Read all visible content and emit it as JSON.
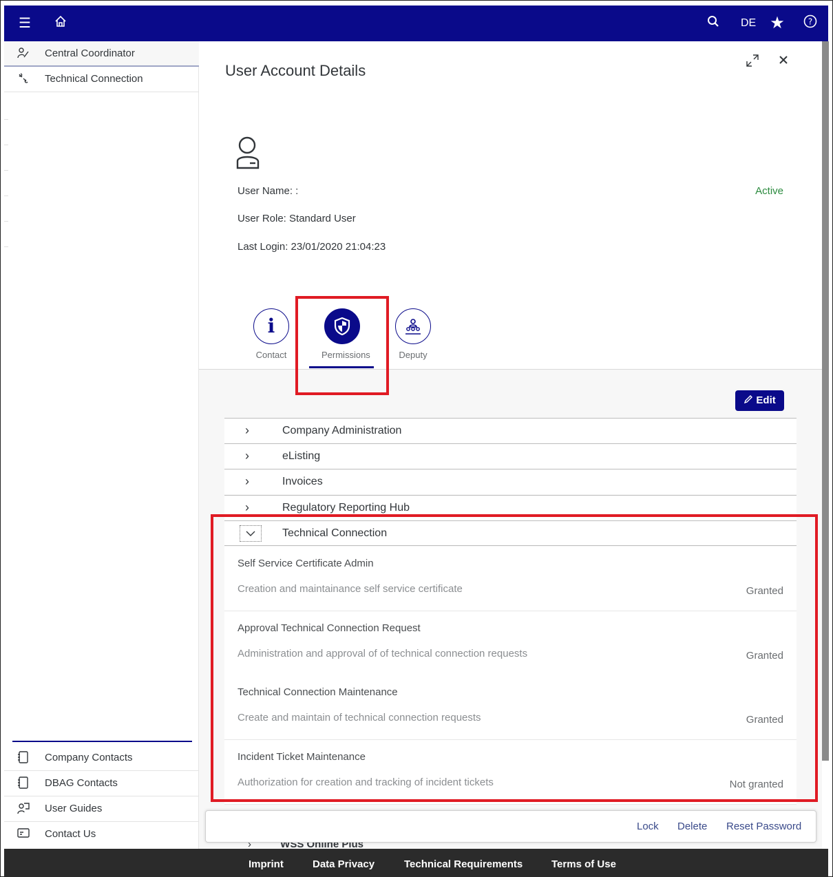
{
  "topbar": {
    "icons": [
      "menu-icon",
      "home-icon",
      "search-icon",
      "star-icon",
      "help-icon"
    ],
    "language": "DE"
  },
  "sidebar": {
    "items": [
      {
        "label": "Central Coordinator",
        "icon": "coordinator-icon"
      },
      {
        "label": "Technical Connection",
        "icon": "connection-icon"
      }
    ],
    "bottom_items": [
      {
        "label": "Company Contacts",
        "icon": "address-book-icon"
      },
      {
        "label": "DBAG Contacts",
        "icon": "address-book-icon"
      },
      {
        "label": "User Guides",
        "icon": "guide-icon"
      },
      {
        "label": "Contact Us",
        "icon": "contact-card-icon"
      }
    ]
  },
  "panel": {
    "title": "User Account Details",
    "user": {
      "name_label": "User Name: :",
      "role_label": "User Role: Standard User",
      "last_login_label": "Last Login: 23/01/2020 21:04:23",
      "status": "Active",
      "status_color": "#2b8a3e"
    },
    "tabs": [
      {
        "label": "Contact",
        "icon": "info-icon"
      },
      {
        "label": "Permissions",
        "icon": "shield-icon",
        "selected": true
      },
      {
        "label": "Deputy",
        "icon": "group-icon"
      }
    ],
    "edit_label": "Edit",
    "accordions": [
      {
        "label": "Company Administration",
        "expanded": false
      },
      {
        "label": "eListing",
        "expanded": false
      },
      {
        "label": "Invoices",
        "expanded": false
      },
      {
        "label": "Regulatory Reporting Hub",
        "expanded": false
      },
      {
        "label": "Technical Connection",
        "expanded": true
      }
    ],
    "permissions": [
      {
        "name": "Self Service Certificate Admin",
        "description": "Creation and maintainance self service certificate",
        "status": "Granted"
      },
      {
        "name": "Approval Technical Connection Request",
        "description": "Administration and approval of of technical connection requests",
        "status": "Granted"
      },
      {
        "name": "Technical Connection Maintenance",
        "description": "Create and maintain of technical connection requests",
        "status": "Granted"
      },
      {
        "name": "Incident Ticket Maintenance",
        "description": "Authorization for creation and tracking of incident tickets",
        "status": "Not granted"
      }
    ],
    "peek_label": "WSS Online Plus",
    "actions": {
      "lock": "Lock",
      "delete": "Delete",
      "reset": "Reset Password"
    }
  },
  "footer": {
    "links": [
      "Imprint",
      "Data Privacy",
      "Technical Requirements",
      "Terms of Use"
    ]
  },
  "colors": {
    "brand": "#0a0a8a",
    "highlight": "#e01b24"
  }
}
